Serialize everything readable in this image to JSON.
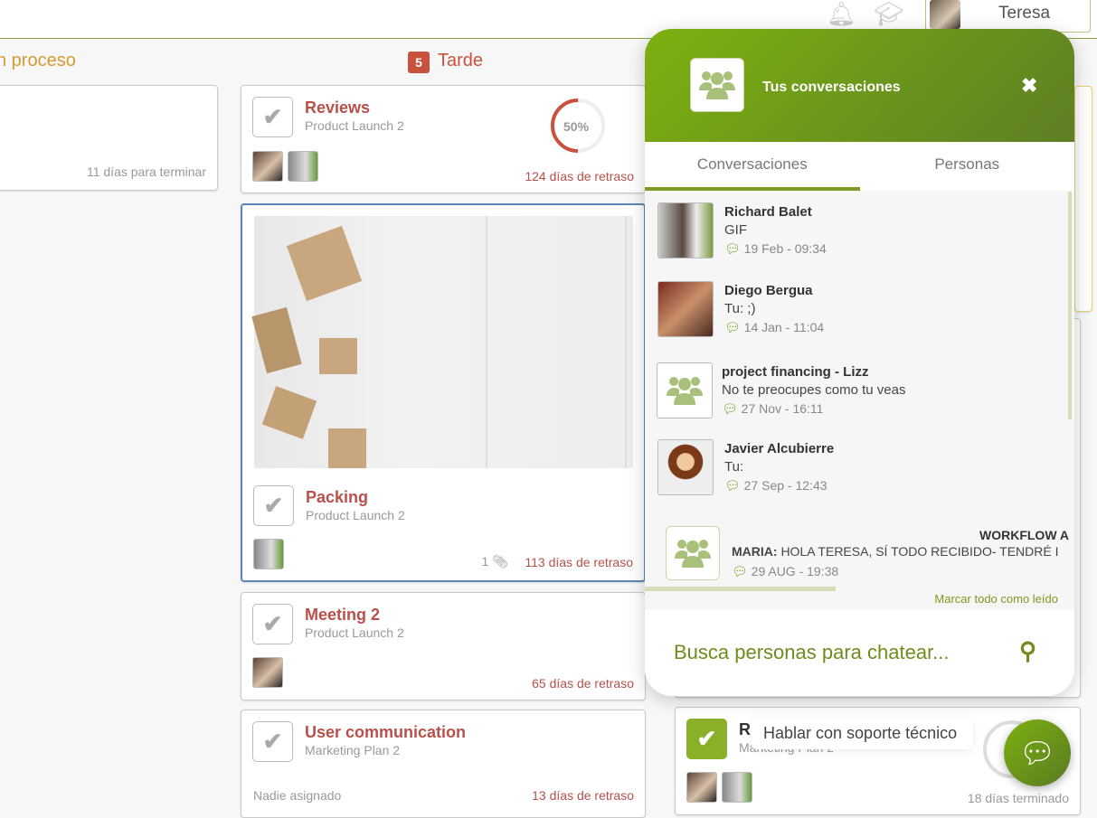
{
  "header": {
    "user_name": "Teresa",
    "icons": [
      "bell-icon",
      "graduation-cap-icon"
    ]
  },
  "columns": [
    {
      "title": "n proceso",
      "color": "#d59a33"
    },
    {
      "title": "Tarde",
      "count": "5",
      "color": "#c9523f"
    }
  ],
  "col1_card": {
    "footer": "11 días para terminar"
  },
  "tasks": [
    {
      "title": "Reviews",
      "project": "Product Launch 2",
      "progress": "50%",
      "footer": "124 días de retraso"
    },
    {
      "title": "Packing",
      "project": "Product Launch 2",
      "attachments": "1",
      "footer": "113 días de retraso"
    },
    {
      "title": "Meeting 2",
      "project": "Product Launch 2",
      "footer": "65 días de retraso"
    },
    {
      "title": "User communication",
      "project": "Marketing Plan 2",
      "assignee": "Nadie asignado",
      "footer": "13 días de retraso"
    }
  ],
  "right_card": {
    "title": "R",
    "project": "Marketing Plan 2",
    "progress": "10",
    "footer": "18 días terminado"
  },
  "chat": {
    "title": "Tus conversaciones",
    "tabs": [
      "Conversaciones",
      "Personas"
    ],
    "conversations": [
      {
        "name": "Richard Balet",
        "message": "GIF",
        "time": "19 Feb - 09:34"
      },
      {
        "name": "Diego Bergua",
        "message": "Tu: ;)",
        "time": "14 Jan - 11:04"
      },
      {
        "name": "project financing - Lizz",
        "message": "No te preocupes como tu veas",
        "time": "27 Nov - 16:11"
      },
      {
        "name": "Javier Alcubierre",
        "message": "Tu:",
        "time": "27 Sep - 12:43"
      },
      {
        "name": "WORKFLOW A",
        "sender": "MARIA:",
        "message": "HOLA TERESA, SÍ TODO RECIBIDO- TENDRÉ I",
        "time": "29 AUG - 19:38"
      }
    ],
    "mark_all_read": "Marcar todo como leído",
    "search_placeholder": "Busca personas para chatear..."
  },
  "support": {
    "tooltip": "Hablar con soporte técnico"
  },
  "colors": {
    "accent": "#7a9a20",
    "late": "#b9504a"
  }
}
